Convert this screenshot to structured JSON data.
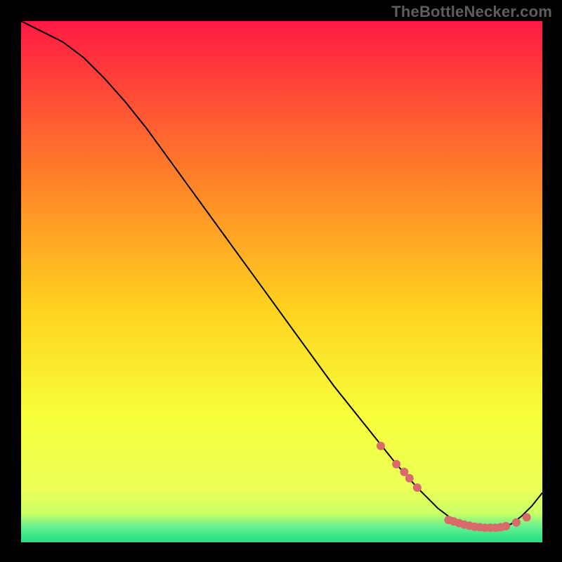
{
  "watermark": "TheBottleNecker.com",
  "colors": {
    "page_bg": "#000000",
    "gradient_top": "#ff1a44",
    "gradient_mid_upper": "#ff7a2a",
    "gradient_mid": "#ffd21f",
    "gradient_mid_lower": "#f7ff3a",
    "gradient_band": "#c8ff66",
    "gradient_bottom": "#1fe086",
    "line": "#000000",
    "marker": "#d86a6a"
  },
  "chart_data": {
    "type": "line",
    "title": "",
    "xlabel": "",
    "ylabel": "",
    "xlim": [
      0,
      100
    ],
    "ylim": [
      0,
      100
    ],
    "series": [
      {
        "name": "curve",
        "x": [
          0,
          4,
          8,
          12,
          16,
          20,
          24,
          28,
          32,
          36,
          40,
          44,
          48,
          52,
          56,
          60,
          64,
          68,
          72,
          76,
          80,
          82,
          84,
          86,
          88,
          90,
          92,
          94,
          96,
          98,
          100
        ],
        "y": [
          100,
          98,
          96,
          93,
          89,
          84.5,
          79.5,
          74,
          68.5,
          63,
          57.5,
          52,
          46.5,
          41,
          35.5,
          30,
          25,
          20,
          15,
          10.5,
          6.5,
          5,
          4,
          3.2,
          2.8,
          2.6,
          2.8,
          3.5,
          5,
          7,
          9.5
        ]
      }
    ],
    "scatter_points": {
      "name": "highlight",
      "points": [
        {
          "x": 69,
          "y": 18.5
        },
        {
          "x": 72,
          "y": 15
        },
        {
          "x": 73.5,
          "y": 13.5
        },
        {
          "x": 74.5,
          "y": 12.3
        },
        {
          "x": 76,
          "y": 10.5
        },
        {
          "x": 82,
          "y": 4.3
        },
        {
          "x": 83,
          "y": 4.0
        },
        {
          "x": 84,
          "y": 3.7
        },
        {
          "x": 85,
          "y": 3.4
        },
        {
          "x": 86,
          "y": 3.2
        },
        {
          "x": 87,
          "y": 3.0
        },
        {
          "x": 88,
          "y": 2.9
        },
        {
          "x": 89,
          "y": 2.8
        },
        {
          "x": 90,
          "y": 2.8
        },
        {
          "x": 91,
          "y": 2.8
        },
        {
          "x": 92,
          "y": 2.9
        },
        {
          "x": 93,
          "y": 3.1
        },
        {
          "x": 95,
          "y": 3.8
        },
        {
          "x": 97,
          "y": 4.8
        }
      ]
    }
  }
}
